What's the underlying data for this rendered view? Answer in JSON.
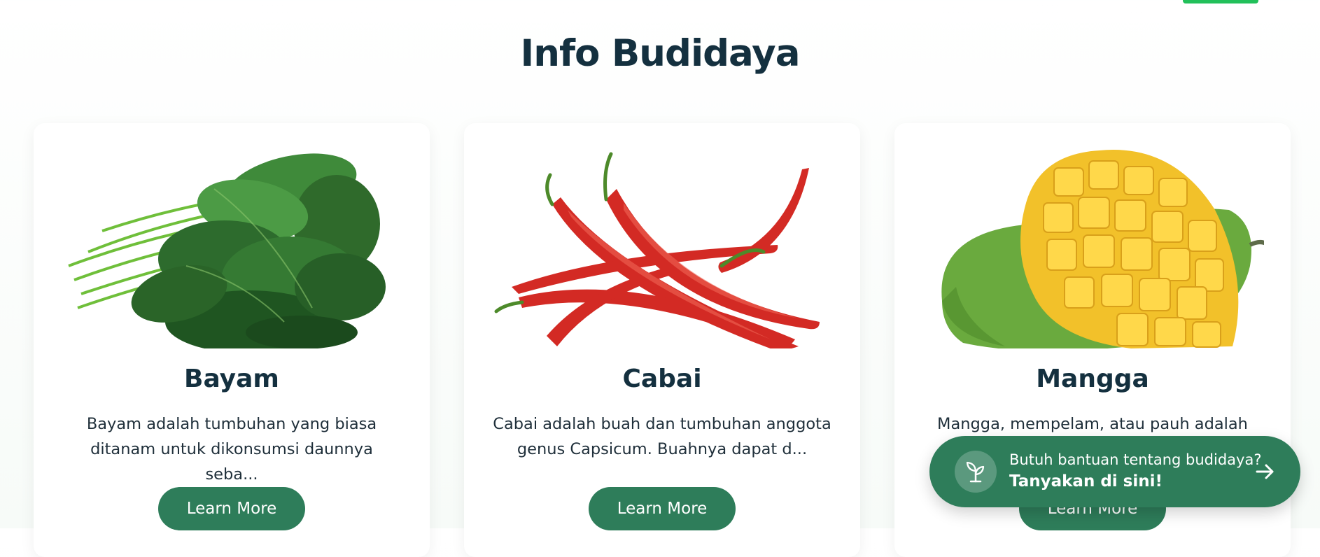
{
  "page": {
    "section_title": "Info Budidaya",
    "accent_color": "#2e7d5a",
    "top_accent_color": "#22c05a"
  },
  "cards": [
    {
      "title": "Bayam",
      "description": "Bayam adalah tumbuhan yang biasa ditanam untuk dikonsumsi daunnya seba...",
      "button_label": "Learn More",
      "image": "spinach-bunch"
    },
    {
      "title": "Cabai",
      "description": "Cabai adalah buah dan tumbuhan anggota genus Capsicum. Buahnya dapat d...",
      "button_label": "Learn More",
      "image": "red-chili-peppers"
    },
    {
      "title": "Mangga",
      "description": "Mangga, mempelam, atau pauh adalah",
      "button_label": "Learn More",
      "image": "cut-mango"
    }
  ],
  "help_button": {
    "line1": "Butuh bantuan tentang budidaya?",
    "line2": "Tanyakan di sini!",
    "icon": "sprout-icon",
    "arrow_icon": "arrow-right-icon"
  }
}
